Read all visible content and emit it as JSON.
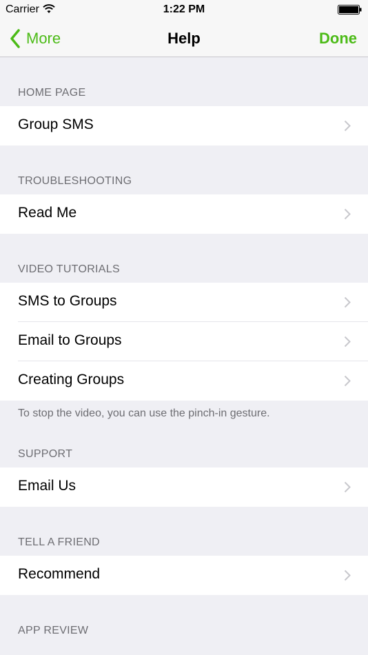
{
  "status_bar": {
    "carrier": "Carrier",
    "time": "1:22 PM"
  },
  "nav": {
    "back_label": "More",
    "title": "Help",
    "done_label": "Done"
  },
  "colors": {
    "accent": "#4cbb17",
    "background": "#efeff4",
    "header_text": "#6d6d72"
  },
  "sections": {
    "home_page": {
      "header": "HOME PAGE",
      "items": [
        "Group SMS"
      ]
    },
    "troubleshooting": {
      "header": "TROUBLESHOOTING",
      "items": [
        "Read Me"
      ]
    },
    "video_tutorials": {
      "header": "VIDEO TUTORIALS",
      "items": [
        "SMS to Groups",
        "Email to Groups",
        "Creating Groups"
      ],
      "footer": "To stop the video, you can use the pinch-in gesture."
    },
    "support": {
      "header": "SUPPORT",
      "items": [
        "Email Us"
      ]
    },
    "tell_a_friend": {
      "header": "TELL A FRIEND",
      "items": [
        "Recommend"
      ]
    },
    "app_review": {
      "header": "APP REVIEW"
    }
  }
}
